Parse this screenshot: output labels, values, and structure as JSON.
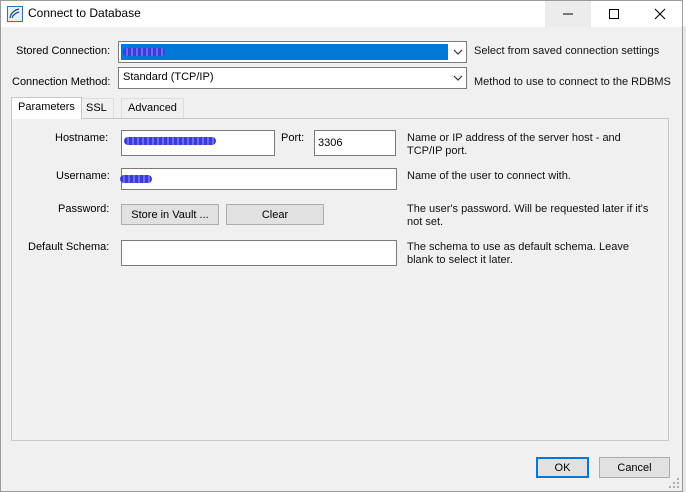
{
  "window": {
    "title": "Connect to Database",
    "minimize_glyph": "—",
    "maximize_glyph": "☐",
    "close_glyph": "✕"
  },
  "stored_connection": {
    "label": "Stored Connection:",
    "help": "Select from saved connection settings"
  },
  "connection_method": {
    "label": "Connection Method:",
    "value": "Standard (TCP/IP)",
    "help": "Method to use to connect to the RDBMS"
  },
  "tabs": [
    {
      "label": "Parameters"
    },
    {
      "label": "SSL"
    },
    {
      "label": "Advanced"
    }
  ],
  "parameters": {
    "hostname": {
      "label": "Hostname:",
      "help": "Name or IP address of the server host - and TCP/IP port."
    },
    "port": {
      "label": "Port:",
      "value": "3306"
    },
    "username": {
      "label": "Username:",
      "help": "Name of the user to connect with."
    },
    "password": {
      "label": "Password:",
      "store_button": "Store in Vault ...",
      "clear_button": "Clear",
      "help": "The user's password. Will be requested later if it's not set."
    },
    "default_schema": {
      "label": "Default Schema:",
      "value": "",
      "help": "The schema to use as default schema. Leave blank to select it later."
    }
  },
  "footer": {
    "ok_label": "OK",
    "cancel_label": "Cancel"
  },
  "colors": {
    "selection": "#0078d7",
    "window_bg": "#f0f0f0",
    "redaction": "#3b3bd8"
  }
}
